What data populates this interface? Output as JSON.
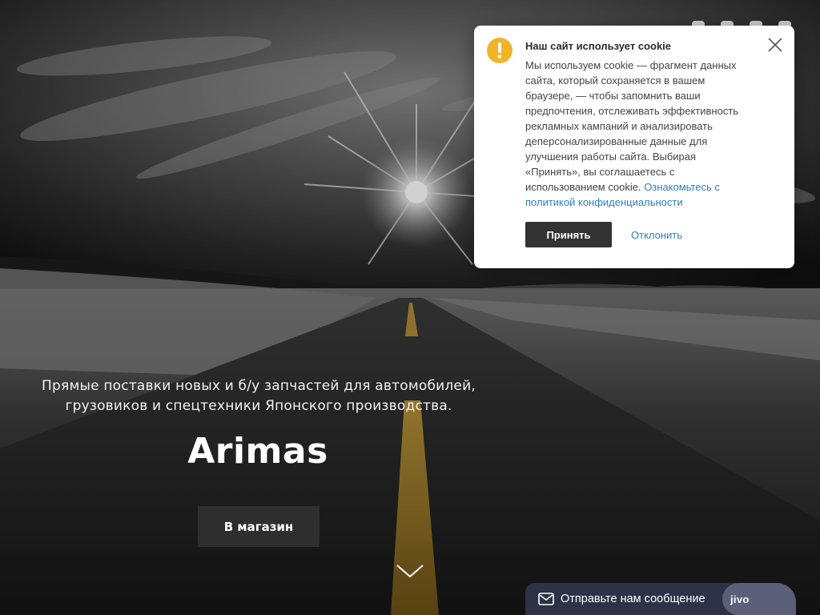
{
  "hero": {
    "tagline_line1": "Прямые поставки новых и б/у запчастей для автомобилей,",
    "tagline_line2": "грузовиков и спецтехники Японского производства.",
    "brand": "Arimas",
    "shop_button": "В магазин",
    "scroll_icon": "chevron-down-icon"
  },
  "social_icons": [
    "instagram-icon",
    "bookmark-icon",
    "phone-icon",
    "user-icon"
  ],
  "cookie": {
    "title": "Наш сайт использует cookie",
    "text": "Мы используем cookie — фрагмент данных сайта, который сохраняется в вашем браузере, — чтобы запомнить ваши предпочтения, отслеживать эффективность рекламных кампаний и анализировать деперсонализированные данные для улучшения работы сайта. Выбирая «Принять», вы соглашаетесь с использованием cookie.",
    "link": "Ознакомьтесь с политикой конфиденциальности",
    "accept": "Принять",
    "decline": "Отклонить",
    "warn_icon": "exclamation-icon",
    "close_icon": "close-icon"
  },
  "chat": {
    "message": "Отправьте нам сообщение",
    "brand": "jivo",
    "icon": "mail-icon"
  },
  "colors": {
    "warn": "#f0b429",
    "link": "#2f7fbf",
    "button_dark": "#2e2e2e",
    "chat_bg": "#2c3247",
    "road_line": "#c8a23a"
  }
}
